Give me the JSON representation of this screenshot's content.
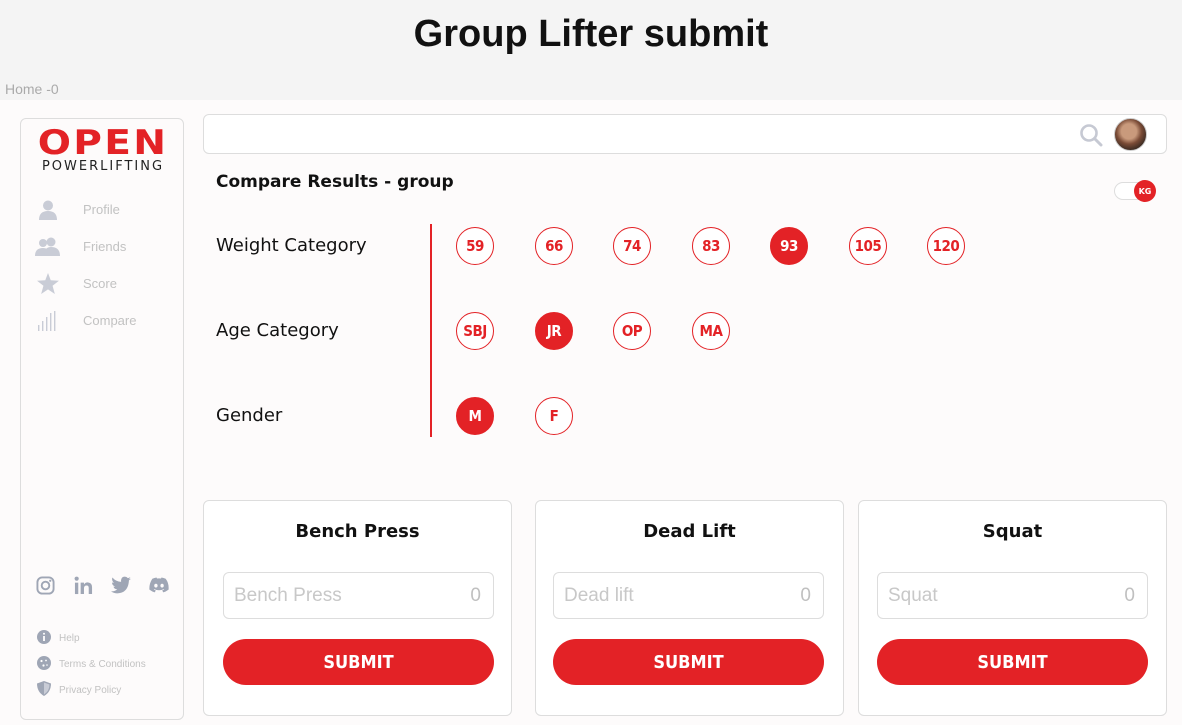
{
  "page_title": "Group Lifter submit",
  "breadcrumb": "Home -0",
  "brand": {
    "name": "OPEN",
    "sub": "POWERLIFTING",
    "accent": "#e32226"
  },
  "sidebar": {
    "items": [
      {
        "label": "Profile",
        "icon": "user-icon"
      },
      {
        "label": "Friends",
        "icon": "friends-icon"
      },
      {
        "label": "Score",
        "icon": "star-icon"
      },
      {
        "label": "Compare",
        "icon": "bar-chart-icon"
      }
    ],
    "social": [
      "instagram-icon",
      "linkedin-icon",
      "twitter-icon",
      "discord-icon"
    ],
    "footer": [
      {
        "label": "Help",
        "icon": "info-icon"
      },
      {
        "label": "Terms & Conditions",
        "icon": "cookie-icon"
      },
      {
        "label": "Privacy Policy",
        "icon": "shield-icon"
      }
    ]
  },
  "search": {
    "placeholder": ""
  },
  "compare": {
    "title": "Compare Results - group",
    "unit_toggle": "KG",
    "rows": [
      {
        "label": "Weight Category",
        "options": [
          "59",
          "66",
          "74",
          "83",
          "93",
          "105",
          "120"
        ],
        "selected": "93"
      },
      {
        "label": "Age Category",
        "options": [
          "SBJ",
          "JR",
          "OP",
          "MA"
        ],
        "selected": "JR"
      },
      {
        "label": "Gender",
        "options": [
          "M",
          "F"
        ],
        "selected": "M"
      }
    ]
  },
  "cards": [
    {
      "title": "Bench Press",
      "placeholder": "Bench Press",
      "value": "0",
      "button": "SUBMIT"
    },
    {
      "title": "Dead Lift",
      "placeholder": "Dead lift",
      "value": "0",
      "button": "SUBMIT"
    },
    {
      "title": "Squat",
      "placeholder": "Squat",
      "value": "0",
      "button": "SUBMIT"
    }
  ]
}
